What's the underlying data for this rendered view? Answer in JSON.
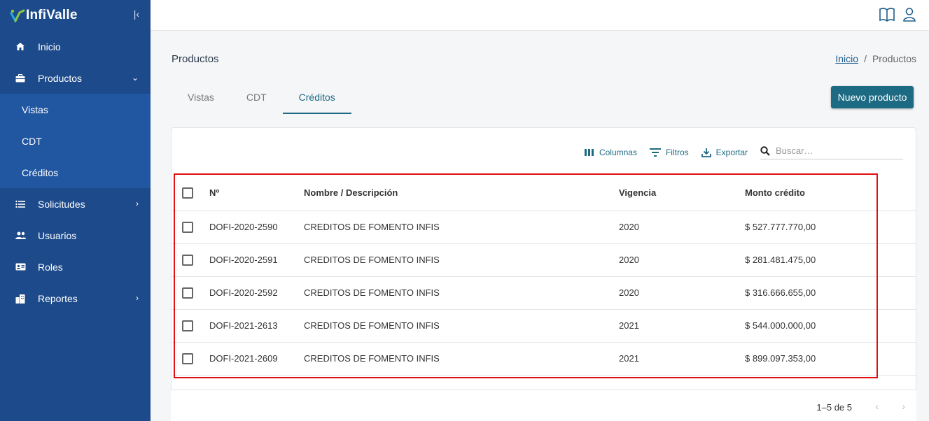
{
  "brand": {
    "name": "InfiValle"
  },
  "sidebar": {
    "collapse_icon": "collapse-left-icon",
    "items": [
      {
        "label": "Inicio",
        "icon": "home-icon"
      },
      {
        "label": "Productos",
        "icon": "briefcase-icon"
      },
      {
        "label": "Solicitudes",
        "icon": "list-icon"
      },
      {
        "label": "Usuarios",
        "icon": "users-icon"
      },
      {
        "label": "Roles",
        "icon": "id-card-icon"
      },
      {
        "label": "Reportes",
        "icon": "building-icon"
      }
    ],
    "sub_items": [
      "Vistas",
      "CDT",
      "Créditos"
    ]
  },
  "topbar": {
    "icons": [
      "book-icon",
      "user-icon"
    ]
  },
  "page": {
    "title": "Productos"
  },
  "breadcrumb": {
    "home": "Inicio",
    "sep": "/",
    "current": "Productos"
  },
  "tabs": [
    "Vistas",
    "CDT",
    "Créditos"
  ],
  "active_tab": "Créditos",
  "new_button": "Nuevo producto",
  "toolbar": {
    "columns": "Columnas",
    "filters": "Filtros",
    "export": "Exportar",
    "search_placeholder": "Buscar…"
  },
  "table": {
    "headers": [
      "Nº",
      "Nombre / Descripción",
      "Vigencia",
      "Monto crédito"
    ],
    "rows": [
      {
        "num": "DOFI-2020-2590",
        "name": "CREDITOS DE FOMENTO INFIS",
        "year": "2020",
        "amount": "$ 527.777.770,00"
      },
      {
        "num": "DOFI-2020-2591",
        "name": "CREDITOS DE FOMENTO INFIS",
        "year": "2020",
        "amount": "$ 281.481.475,00"
      },
      {
        "num": "DOFI-2020-2592",
        "name": "CREDITOS DE FOMENTO INFIS",
        "year": "2020",
        "amount": "$ 316.666.655,00"
      },
      {
        "num": "DOFI-2021-2613",
        "name": "CREDITOS DE FOMENTO INFIS",
        "year": "2021",
        "amount": "$ 544.000.000,00"
      },
      {
        "num": "DOFI-2021-2609",
        "name": "CREDITOS DE FOMENTO INFIS",
        "year": "2021",
        "amount": "$ 899.097.353,00"
      }
    ]
  },
  "pagination": {
    "info": "1–5 de 5",
    "prev": "‹",
    "next": "›"
  },
  "colors": {
    "sidebar": "#1c4a8a",
    "submenu": "#2156a0",
    "accent": "#1d6a83",
    "highlight": "#e01010"
  }
}
